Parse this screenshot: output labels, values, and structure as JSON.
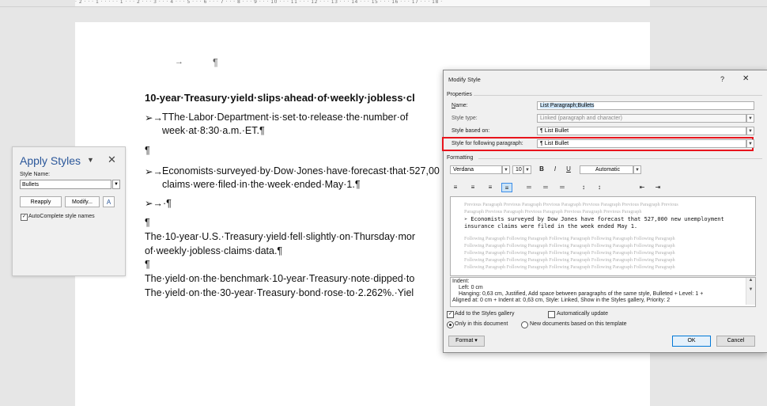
{
  "ruler": {
    "text": "· 2 · · · 1 · · · · · 1 · · · 2 · · · 3 · · · 4 · · · 5 · · · 6 · · · 7 · · · 8 · · · 9 · · · 10 · · · 11 · · · 12 · · · 13 · · · 14 · · · 15 · · · 16 · · · 17 · · · 18 ·"
  },
  "document": {
    "arrow_line": "→",
    "pilcrow_top": "¶",
    "headline": "10-year·Treasury·yield·slips·ahead·of·weekly·jobless·cl",
    "bullet1_prefix": "➢→",
    "bullet1_line1": "TThe·Labor·Department·is·set·to·release·the·number·of",
    "bullet1_line2": "week·at·8:30·a.m.·ET.¶",
    "pilcrow1": "¶",
    "bullet2_prefix": "➢→",
    "bullet2_line1": "Economists·surveyed·by·Dow·Jones·have·forecast·that·527,00",
    "bullet2_line2": "claims·were·filed·in·the·week·ended·May·1.¶",
    "bullet3": "➢→·¶",
    "pilcrow2": "¶",
    "para1_line1": "The·10-year·U.S.·Treasury·yield·fell·slightly·on·Thursday·mor",
    "para1_line2": "of·weekly·jobless·claims·data.¶",
    "pilcrow3": "¶",
    "para2_line1": "The·yield·on·the·benchmark·10-year·Treasury·note·dipped·to",
    "para2_line2": "The·yield·on·the·30-year·Treasury·bond·rose·to·2.262%.·Yiel"
  },
  "apply_styles": {
    "title": "Apply Styles",
    "pin_icon_glyph": "▼",
    "close_glyph": "✕",
    "style_name_label": "Style Name:",
    "style_name_value": "Bullets",
    "reapply_label": "Reapply",
    "modify_label": "Modify...",
    "autocomplete_label": "AutoComplete style names",
    "autocomplete_checked": "✓"
  },
  "dialog": {
    "title": "Modify Style",
    "help": "?",
    "close": "✕",
    "properties_header": "Properties",
    "name_label": "Name:",
    "name_value": "List Paragraph;Bullets",
    "style_type_label": "Style type:",
    "style_type_value": "Linked (paragraph and character)",
    "style_based_label": "Style based on:",
    "style_based_value": "¶  List Bullet",
    "style_following_label": "Style for following paragraph:",
    "style_following_value": "¶  List Bullet",
    "formatting_header": "Formatting",
    "font_value": "Verdana",
    "size_value": "10",
    "bold": "B",
    "italic": "I",
    "underline": "U",
    "color_value": "Automatic",
    "align_icons": [
      "≡",
      "≡",
      "≡",
      "≡",
      "═",
      "═",
      "═",
      "↕",
      "↕",
      "⇤",
      "⇥"
    ],
    "preview_prev1": "Previous Paragraph Previous Paragraph Previous Paragraph Previous Paragraph Previous Paragraph Previous",
    "preview_prev2": "Paragraph Previous Paragraph Previous Paragraph Previous Paragraph Previous Paragraph",
    "preview_main1": "➢  Economists surveyed by Dow Jones have forecast that 527,000 new unemployment",
    "preview_main2": "   insurance claims were filed in the week ended May 1.",
    "preview_follow": "Following Paragraph Following Paragraph Following Paragraph Following Paragraph Following Paragraph",
    "desc1": "Indent:",
    "desc2": "Left:  0 cm",
    "desc3": "Hanging:  0,63 cm, Justified, Add space between paragraphs of the same style, Bulleted + Level: 1 +",
    "desc4": "Aligned at:  0 cm + Indent at:  0,63 cm, Style: Linked, Show in the Styles gallery, Priority: 2",
    "add_gallery_label": "Add to the Styles gallery",
    "auto_update_label": "Automatically update",
    "only_doc_label": "Only in this document",
    "new_docs_label": "New documents based on this template",
    "format_label": "Format ▾",
    "ok_label": "OK",
    "cancel_label": "Cancel",
    "check": "✓"
  },
  "colors": {
    "highlight": "#e8141c",
    "accent": "#2b579a",
    "selection": "#cce4f7"
  }
}
